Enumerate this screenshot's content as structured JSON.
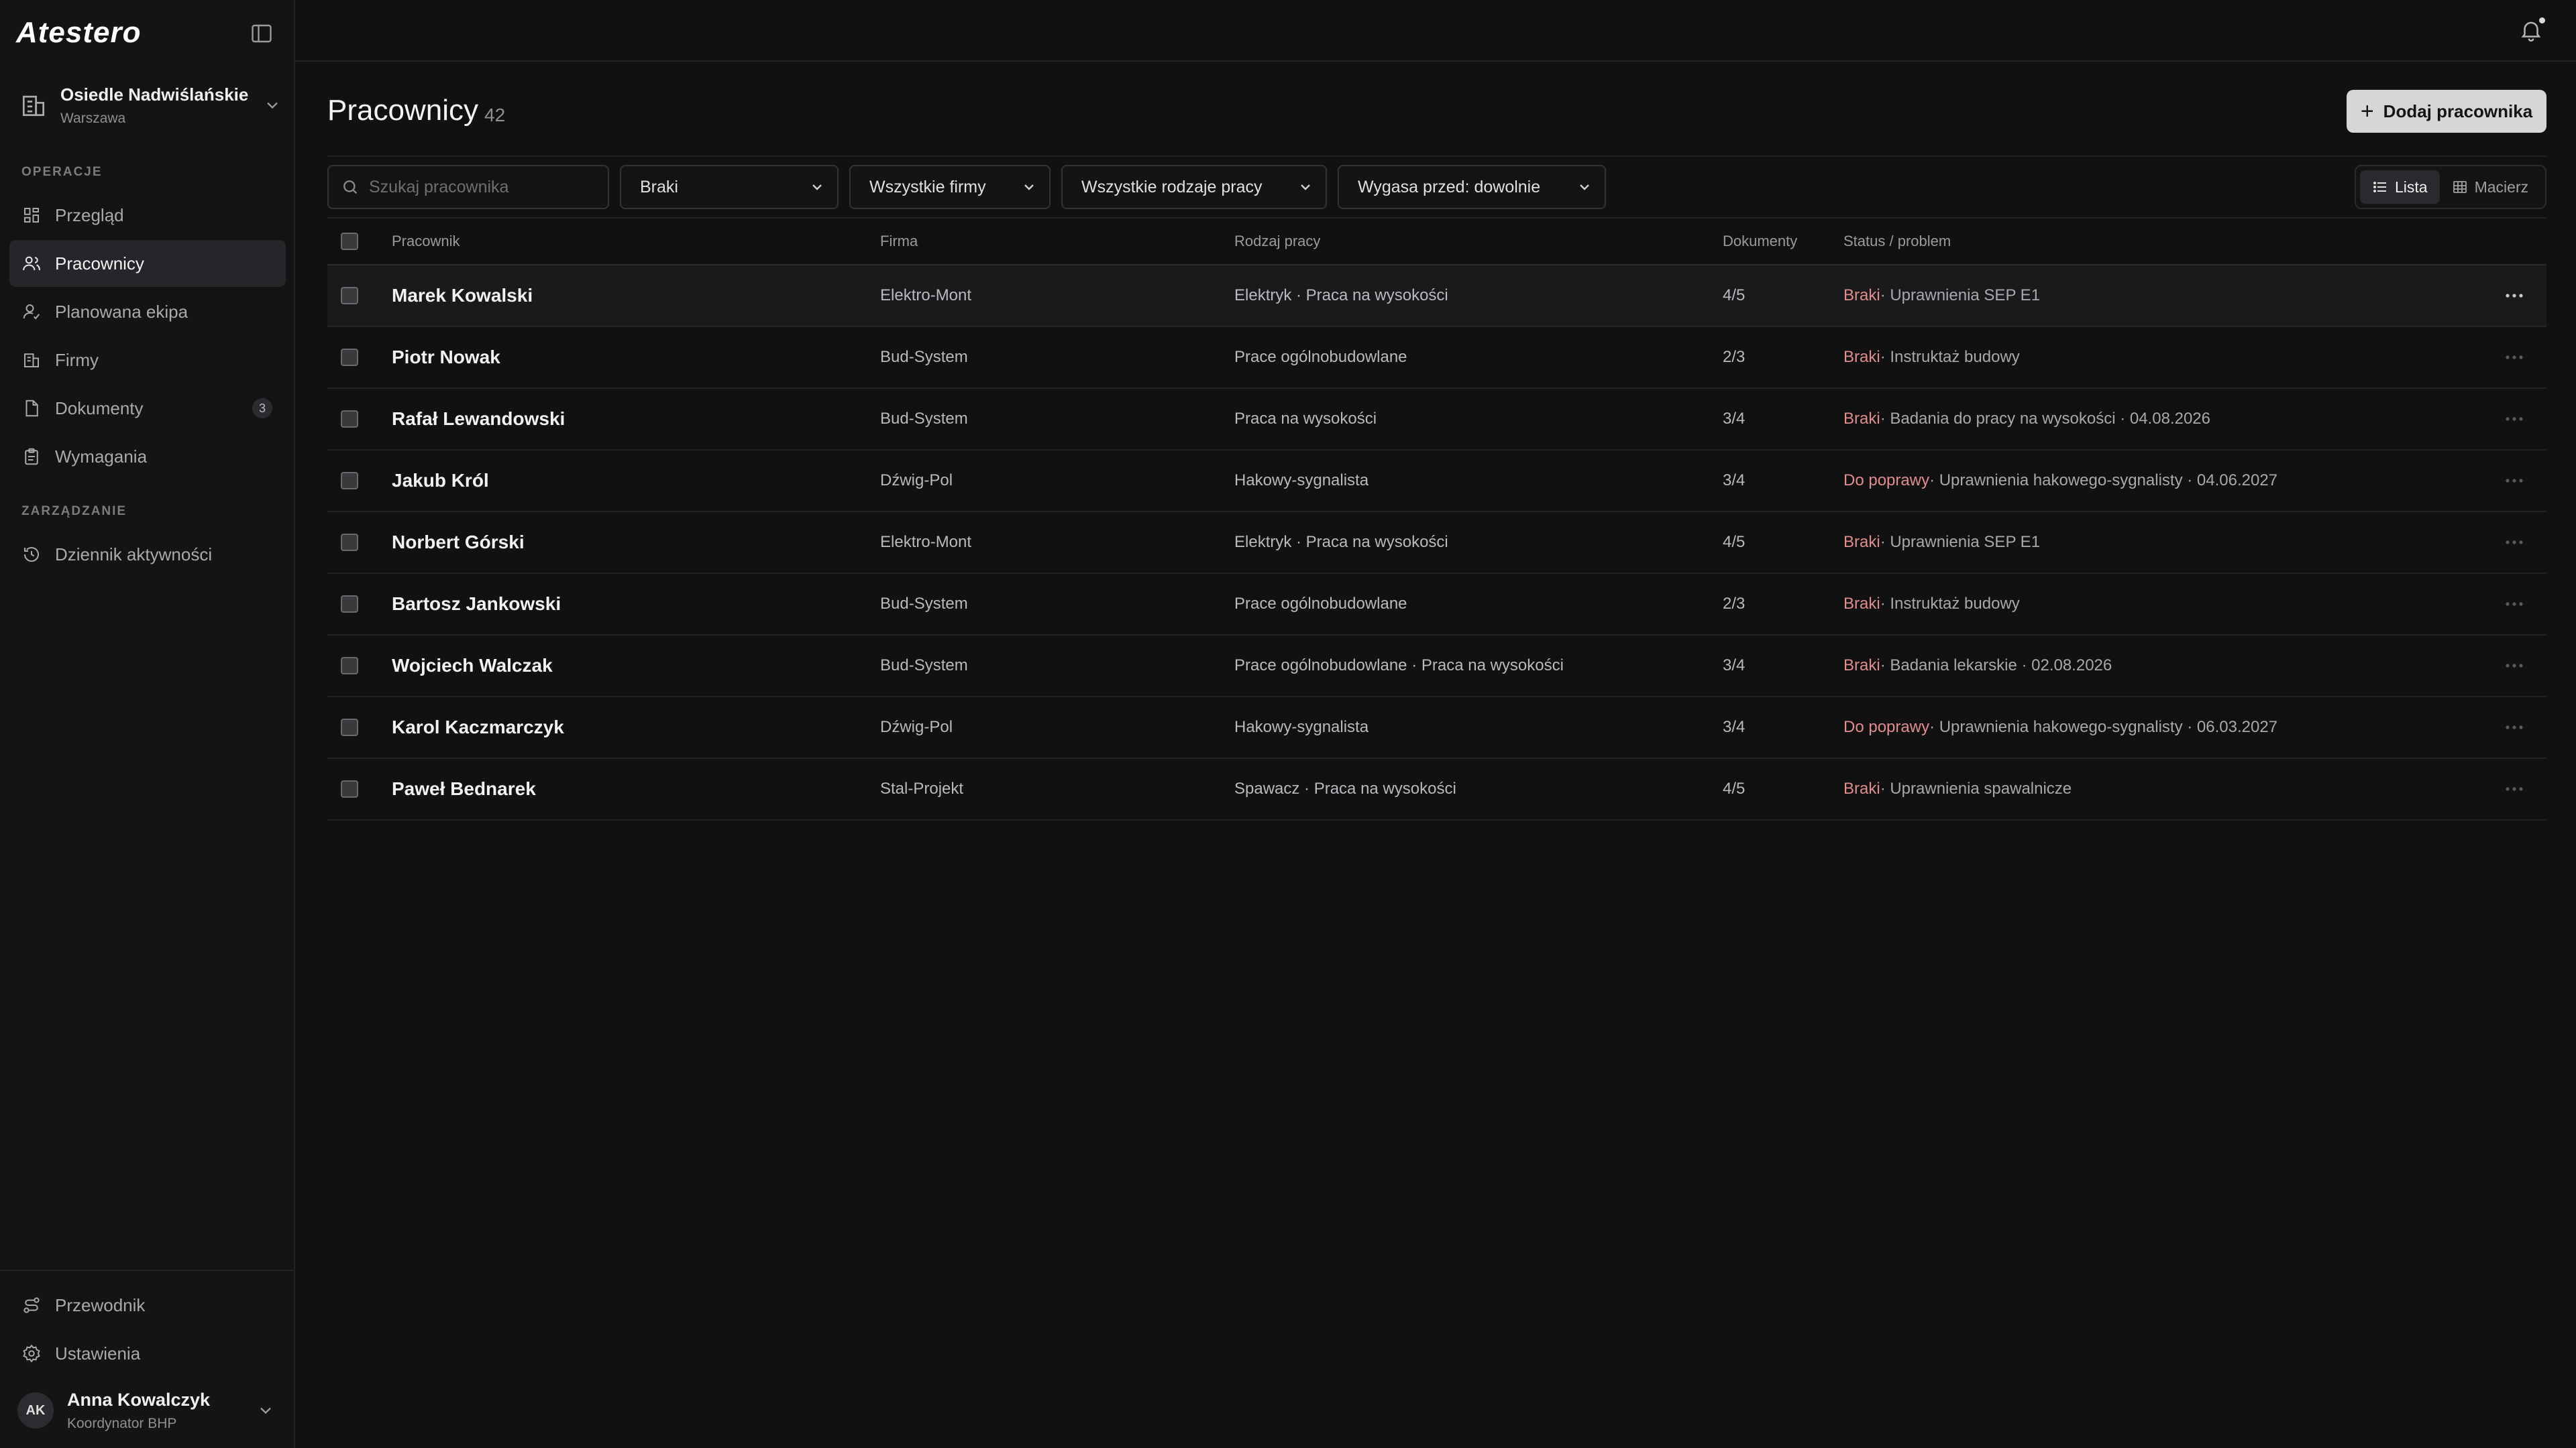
{
  "app": {
    "logo": "Atestero"
  },
  "org": {
    "name": "Osiedle Nadwiślańskie",
    "city": "Warszawa"
  },
  "sidebar": {
    "section_ops": "OPERACJE",
    "section_mgmt": "ZARZĄDZANIE",
    "items": [
      {
        "label": "Przegląd",
        "icon": "grid-icon"
      },
      {
        "label": "Pracownicy",
        "icon": "users-icon",
        "active": true
      },
      {
        "label": "Planowana ekipa",
        "icon": "user-plan-icon"
      },
      {
        "label": "Firmy",
        "icon": "building-icon"
      },
      {
        "label": "Dokumenty",
        "icon": "document-icon",
        "badge": "3"
      },
      {
        "label": "Wymagania",
        "icon": "clipboard-icon"
      }
    ],
    "mgmt_items": [
      {
        "label": "Dziennik aktywności",
        "icon": "history-icon"
      }
    ],
    "bottom_items": [
      {
        "label": "Przewodnik",
        "icon": "guide-icon"
      },
      {
        "label": "Ustawienia",
        "icon": "gear-icon"
      }
    ]
  },
  "user": {
    "initials": "AK",
    "name": "Anna Kowalczyk",
    "role": "Koordynator BHP"
  },
  "main": {
    "title": "Pracownicy",
    "count": "42",
    "add_button": "Dodaj pracownika",
    "search_placeholder": "Szukaj pracownika",
    "filters": {
      "status": "Braki",
      "firms": "Wszystkie firmy",
      "work_types": "Wszystkie rodzaje pracy",
      "expires": "Wygasa przed: dowolnie"
    },
    "view_toggle": {
      "list": "Lista",
      "matrix": "Macierz"
    }
  },
  "table": {
    "headers": {
      "name": "Pracownik",
      "firm": "Firma",
      "type": "Rodzaj pracy",
      "docs": "Dokumenty",
      "status": "Status / problem"
    },
    "rows": [
      {
        "name": "Marek Kowalski",
        "firm": "Elektro-Mont",
        "type": "Elektryk · Praca na wysokości",
        "docs": "4/5",
        "status_key": "Braki",
        "status_rest": "· Uprawnienia SEP E1"
      },
      {
        "name": "Piotr Nowak",
        "firm": "Bud-System",
        "type": "Prace ogólnobudowlane",
        "docs": "2/3",
        "status_key": "Braki",
        "status_rest": "· Instruktaż budowy"
      },
      {
        "name": "Rafał Lewandowski",
        "firm": "Bud-System",
        "type": "Praca na wysokości",
        "docs": "3/4",
        "status_key": "Braki",
        "status_rest": "· Badania do pracy na wysokości · 04.08.2026"
      },
      {
        "name": "Jakub Król",
        "firm": "Dźwig-Pol",
        "type": "Hakowy-sygnalista",
        "docs": "3/4",
        "status_key": "Do poprawy",
        "status_rest": "· Uprawnienia hakowego-sygnalisty · 04.06.2027"
      },
      {
        "name": "Norbert Górski",
        "firm": "Elektro-Mont",
        "type": "Elektryk · Praca na wysokości",
        "docs": "4/5",
        "status_key": "Braki",
        "status_rest": "· Uprawnienia SEP E1"
      },
      {
        "name": "Bartosz Jankowski",
        "firm": "Bud-System",
        "type": "Prace ogólnobudowlane",
        "docs": "2/3",
        "status_key": "Braki",
        "status_rest": "· Instruktaż budowy"
      },
      {
        "name": "Wojciech Walczak",
        "firm": "Bud-System",
        "type": "Prace ogólnobudowlane · Praca na wysokości",
        "docs": "3/4",
        "status_key": "Braki",
        "status_rest": "· Badania lekarskie · 02.08.2026"
      },
      {
        "name": "Karol Kaczmarczyk",
        "firm": "Dźwig-Pol",
        "type": "Hakowy-sygnalista",
        "docs": "3/4",
        "status_key": "Do poprawy",
        "status_rest": "· Uprawnienia hakowego-sygnalisty · 06.03.2027"
      },
      {
        "name": "Paweł Bednarek",
        "firm": "Stal-Projekt",
        "type": "Spawacz · Praca na wysokości",
        "docs": "4/5",
        "status_key": "Braki",
        "status_rest": "· Uprawnienia spawalnicze"
      }
    ]
  },
  "colors": {
    "background": "#111112",
    "sidebar": "#141415",
    "accent_issue": "#e28d8d",
    "button": "#d6d6d6"
  }
}
